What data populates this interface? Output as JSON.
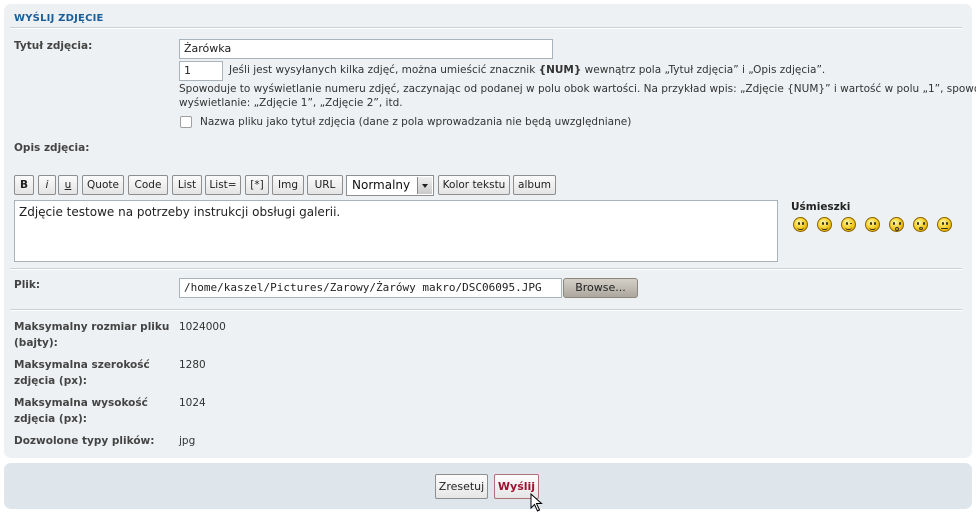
{
  "section": {
    "title": "WYŚLIJ ZDJĘCIE"
  },
  "title_field": {
    "label": "Tytuł zdjęcia:",
    "value": "Żarówka",
    "counter_value": "1",
    "hint_line1_pre": "Jeśli jest wysyłanych kilka zdjęć, można umieścić znacznik ",
    "hint_line1_tag": "{NUM}",
    "hint_line1_post": " wewnątrz pola „Tytuł zdjęcia” i „Opis zdjęcia”.",
    "hint_line2": "Spowoduje to wyświetlanie numeru zdjęć, zaczynając od podanej w polu obok wartości. Na przykład wpis: „Zdjęcie {NUM}” i wartość w polu „1”, spowoduje",
    "hint_line3": "wyświetlanie: „Zdjęcie 1”, „Zdjęcie 2”, itd.",
    "checkbox_label": "Nazwa pliku jako tytuł zdjęcia (dane z pola wprowadzania nie będą uwzględniane)"
  },
  "description": {
    "label": "Opis zdjęcia:",
    "toolbar": {
      "bold": "B",
      "italic": "i",
      "underline": "u",
      "quote": "Quote",
      "code": "Code",
      "list": "List",
      "list_eq": "List=",
      "list_item": "[*]",
      "img": "Img",
      "url": "URL",
      "size_selected": "Normalny",
      "color": "Kolor tekstu",
      "album": "album"
    },
    "value": "Zdjęcie testowe na potrzeby instrukcji obsługi galerii.",
    "smilies_label": "Uśmieszki",
    "smiley_icons": [
      "grin-icon",
      "smile-icon",
      "wink-icon",
      "happy-icon",
      "surprised-icon",
      "shocked-icon",
      "confused-icon"
    ]
  },
  "file": {
    "label": "Plik:",
    "value": "/home/kaszel/Pictures/Zarowy/Żarówy makro/DSC06095.JPG",
    "browse_label": "Browse..."
  },
  "info": [
    {
      "label_l1": "Maksymalny rozmiar pliku",
      "label_l2": "(bajty):",
      "value": "1024000"
    },
    {
      "label_l1": "Maksymalna szerokość",
      "label_l2": "zdjęcia (px):",
      "value": "1280"
    },
    {
      "label_l1": "Maksymalna wysokość",
      "label_l2": "zdjęcia (px):",
      "value": "1024"
    },
    {
      "label_l1": "Dozwolone typy plików:",
      "label_l2": "",
      "value": "jpg"
    }
  ],
  "footer": {
    "reset_label": "Zresetuj",
    "submit_label": "Wyślij"
  },
  "colors": {
    "accent": "#1a5e99",
    "panel": "#eef1f3",
    "footer": "#dfe6eb",
    "submit": "#a01030"
  }
}
